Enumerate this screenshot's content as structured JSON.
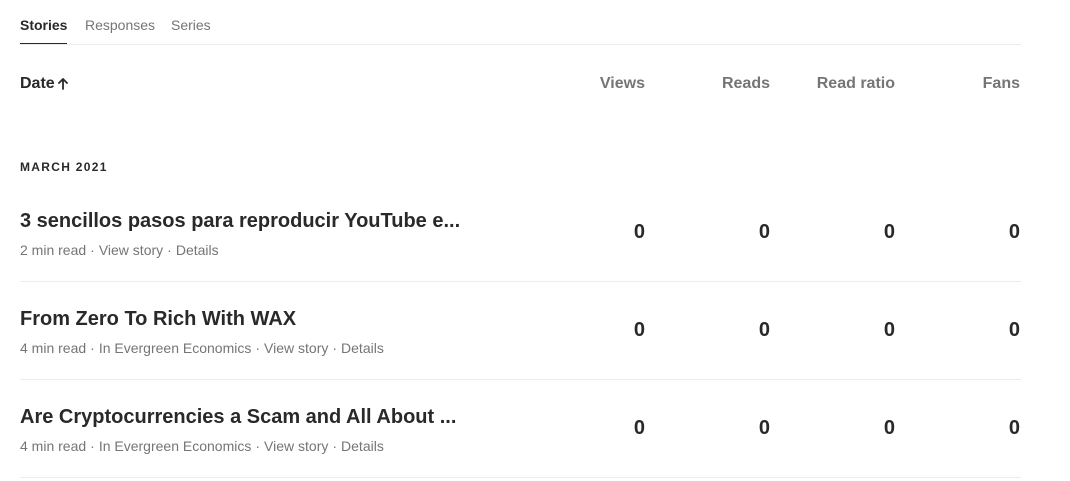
{
  "tabs": [
    {
      "label": "Stories",
      "active": true
    },
    {
      "label": "Responses",
      "active": false
    },
    {
      "label": "Series",
      "active": false
    }
  ],
  "columns": {
    "date": "Date",
    "date_sort_icon": "arrow-up-icon",
    "views": "Views",
    "reads": "Reads",
    "read_ratio": "Read ratio",
    "fans": "Fans"
  },
  "section": "MARCH 2021",
  "stories": [
    {
      "title": "3 sencillos pasos para reproducir YouTube e...",
      "read_time": "2 min read",
      "publication": "",
      "view_story": "View story",
      "details": "Details",
      "views": "0",
      "reads": "0",
      "read_ratio": "0",
      "fans": "0"
    },
    {
      "title": "From Zero To Rich With WAX",
      "read_time": "4 min read",
      "publication": "In Evergreen Economics",
      "view_story": "View story",
      "details": "Details",
      "views": "0",
      "reads": "0",
      "read_ratio": "0",
      "fans": "0"
    },
    {
      "title": "Are Cryptocurrencies a Scam and All About ...",
      "read_time": "4 min read",
      "publication": "In Evergreen Economics",
      "view_story": "View story",
      "details": "Details",
      "views": "0",
      "reads": "0",
      "read_ratio": "0",
      "fans": "0"
    }
  ]
}
